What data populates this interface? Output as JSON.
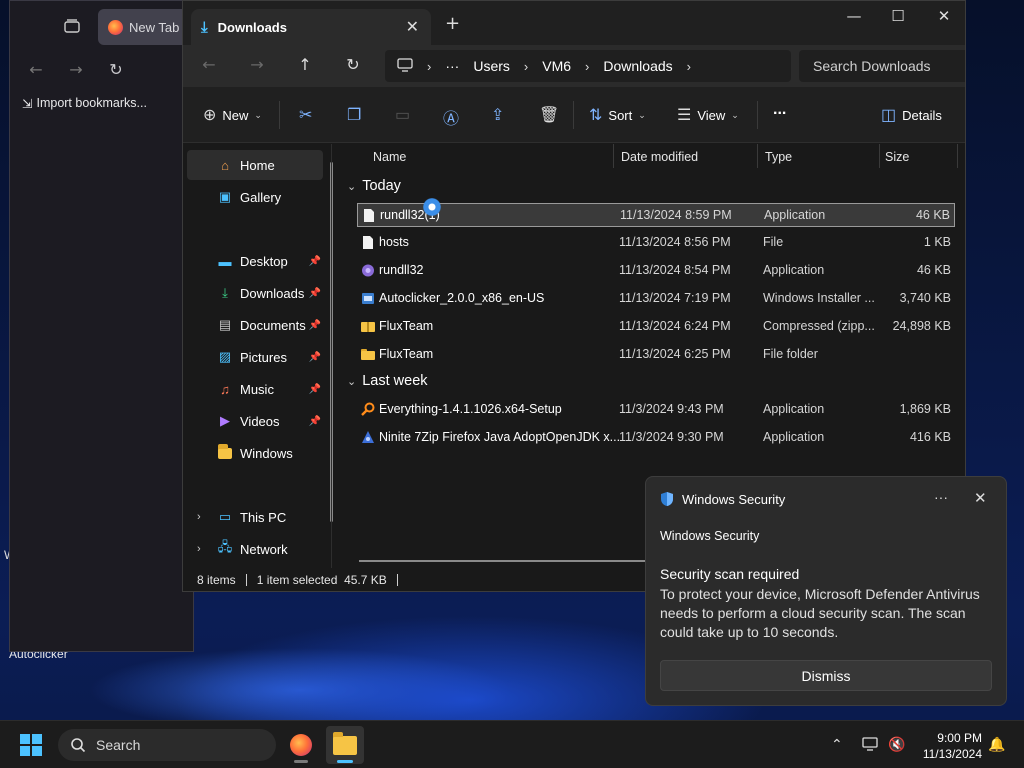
{
  "desktop": {
    "icon_label": "Autoclicker",
    "partial_char": "W"
  },
  "firefox": {
    "tab_title": "New Tab",
    "bookmark_import": "Import bookmarks..."
  },
  "explorer": {
    "tab_title": "Downloads",
    "breadcrumb": [
      "Users",
      "VM6",
      "Downloads"
    ],
    "search_placeholder": "Search Downloads",
    "toolbar": {
      "new_label": "New",
      "sort_label": "Sort",
      "view_label": "View",
      "more_label": "...",
      "details_label": "Details"
    },
    "nav": {
      "home": "Home",
      "gallery": "Gallery",
      "desktop": "Desktop",
      "downloads": "Downloads",
      "documents": "Documents",
      "pictures": "Pictures",
      "music": "Music",
      "videos": "Videos",
      "windows": "Windows",
      "this_pc": "This PC",
      "network": "Network"
    },
    "columns": {
      "name": "Name",
      "date": "Date modified",
      "type": "Type",
      "size": "Size"
    },
    "groups": {
      "today": "Today",
      "last_week": "Last week"
    },
    "files_today": [
      {
        "name": "rundll32(1)",
        "date": "11/13/2024 8:59 PM",
        "type": "Application",
        "size": "46 KB",
        "icon": "app-icon"
      },
      {
        "name": "hosts",
        "date": "11/13/2024 8:56 PM",
        "type": "File",
        "size": "1 KB",
        "icon": "file-icon"
      },
      {
        "name": "rundll32",
        "date": "11/13/2024 8:54 PM",
        "type": "Application",
        "size": "46 KB",
        "icon": "app-icon"
      },
      {
        "name": "Autoclicker_2.0.0_x86_en-US",
        "date": "11/13/2024 7:19 PM",
        "type": "Windows Installer ...",
        "size": "3,740 KB",
        "icon": "installer-icon"
      },
      {
        "name": "FluxTeam",
        "date": "11/13/2024 6:24 PM",
        "type": "Compressed (zipp...",
        "size": "24,898 KB",
        "icon": "zip-folder-icon"
      },
      {
        "name": "FluxTeam",
        "date": "11/13/2024 6:25 PM",
        "type": "File folder",
        "size": "",
        "icon": "folder-icon"
      }
    ],
    "files_last_week": [
      {
        "name": "Everything-1.4.1.1026.x64-Setup",
        "date": "11/3/2024 9:43 PM",
        "type": "Application",
        "size": "1,869 KB",
        "icon": "search-app-icon"
      },
      {
        "name": "Ninite 7Zip Firefox Java AdoptOpenJDK x...",
        "date": "11/3/2024 9:30 PM",
        "type": "Application",
        "size": "416 KB",
        "icon": "ninite-icon"
      }
    ],
    "status": {
      "count": "8 items",
      "selection": "1 item selected  45.7 KB"
    }
  },
  "toast": {
    "app_name": "Windows Security",
    "app_subtitle": "Windows Security",
    "title": "Security scan required",
    "body": "To protect your device, Microsoft Defender Antivirus needs to perform a cloud security scan. The scan could take up to 10 seconds.",
    "button": "Dismiss",
    "more": "···"
  },
  "taskbar": {
    "search_label": "Search",
    "time": "9:00 PM",
    "date": "11/13/2024"
  },
  "colors": {
    "accent": "#4cc2ff",
    "folder": "#f6c445",
    "selected_row": "#3a3a3a"
  }
}
